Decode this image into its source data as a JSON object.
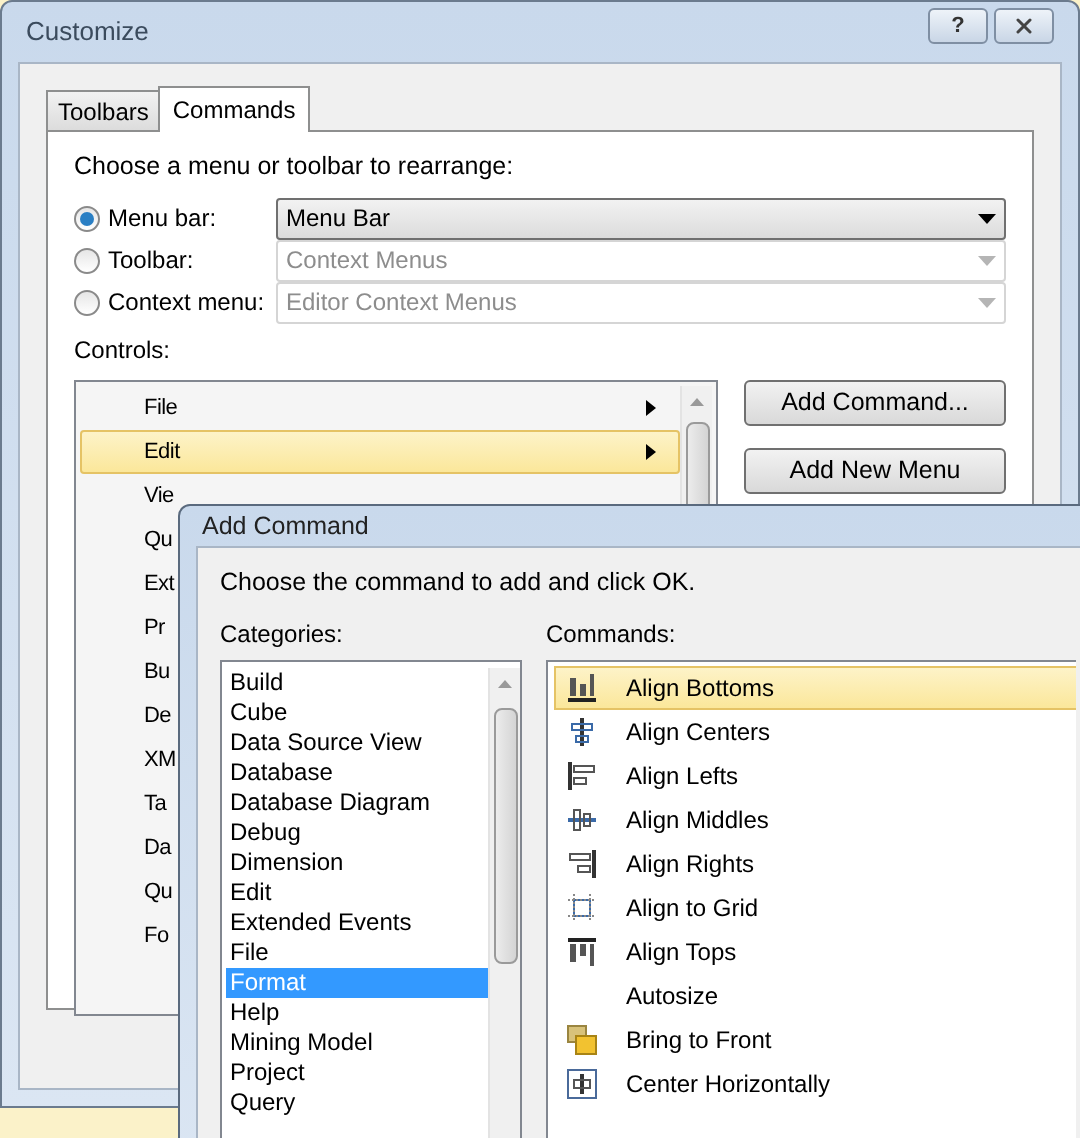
{
  "customize": {
    "title": "Customize",
    "help_button": "?",
    "tabs": [
      {
        "label": "Toolbars",
        "selected": false
      },
      {
        "label": "Commands",
        "selected": true
      }
    ],
    "prompt": "Choose a menu or toolbar to rearrange:",
    "options": [
      {
        "label": "Menu bar:",
        "selected": true,
        "value": "Menu Bar",
        "disabled": false
      },
      {
        "label": "Toolbar:",
        "selected": false,
        "value": "Context Menus",
        "disabled": true
      },
      {
        "label": "Context menu:",
        "selected": false,
        "value": "Editor Context Menus",
        "disabled": true
      }
    ],
    "controls_label": "Controls:",
    "controls": [
      {
        "label": "File",
        "selected": false,
        "submenu": true
      },
      {
        "label": "Edit",
        "selected": true,
        "submenu": true
      },
      {
        "label": "Vie",
        "selected": false
      },
      {
        "label": "Qu",
        "selected": false
      },
      {
        "label": "Ext",
        "selected": false
      },
      {
        "label": "Pr",
        "selected": false
      },
      {
        "label": "Bu",
        "selected": false
      },
      {
        "label": "De",
        "selected": false
      },
      {
        "label": "XM",
        "selected": false
      },
      {
        "label": "Ta",
        "selected": false
      },
      {
        "label": "Da",
        "selected": false
      },
      {
        "label": "Qu",
        "selected": false
      },
      {
        "label": "Fo",
        "selected": false
      }
    ],
    "buttons": [
      "Add Command...",
      "Add New Menu"
    ]
  },
  "add_command": {
    "title": "Add Command",
    "prompt": "Choose the command to add and click OK.",
    "categories_label": "Categories:",
    "categories": [
      {
        "label": "Build",
        "selected": false
      },
      {
        "label": "Cube",
        "selected": false
      },
      {
        "label": "Data Source View",
        "selected": false
      },
      {
        "label": "Database",
        "selected": false
      },
      {
        "label": "Database Diagram",
        "selected": false
      },
      {
        "label": "Debug",
        "selected": false
      },
      {
        "label": "Dimension",
        "selected": false
      },
      {
        "label": "Edit",
        "selected": false
      },
      {
        "label": "Extended Events",
        "selected": false
      },
      {
        "label": "File",
        "selected": false
      },
      {
        "label": "Format",
        "selected": true
      },
      {
        "label": "Help",
        "selected": false
      },
      {
        "label": "Mining Model",
        "selected": false
      },
      {
        "label": "Project",
        "selected": false
      },
      {
        "label": "Query",
        "selected": false
      }
    ],
    "commands_label": "Commands:",
    "commands": [
      {
        "label": "Align Bottoms",
        "selected": true,
        "kind": "bottoms"
      },
      {
        "label": "Align Centers",
        "selected": false,
        "kind": "centers"
      },
      {
        "label": "Align Lefts",
        "selected": false,
        "kind": "lefts"
      },
      {
        "label": "Align Middles",
        "selected": false,
        "kind": "middles"
      },
      {
        "label": "Align Rights",
        "selected": false,
        "kind": "rights"
      },
      {
        "label": "Align to Grid",
        "selected": false,
        "kind": "grid"
      },
      {
        "label": "Align Tops",
        "selected": false,
        "kind": "tops"
      },
      {
        "label": "Autosize",
        "selected": false,
        "kind": "plain"
      },
      {
        "label": "Bring to Front",
        "selected": false,
        "kind": "front"
      },
      {
        "label": "Center Horizontally",
        "selected": false,
        "kind": "hcenter"
      }
    ]
  }
}
